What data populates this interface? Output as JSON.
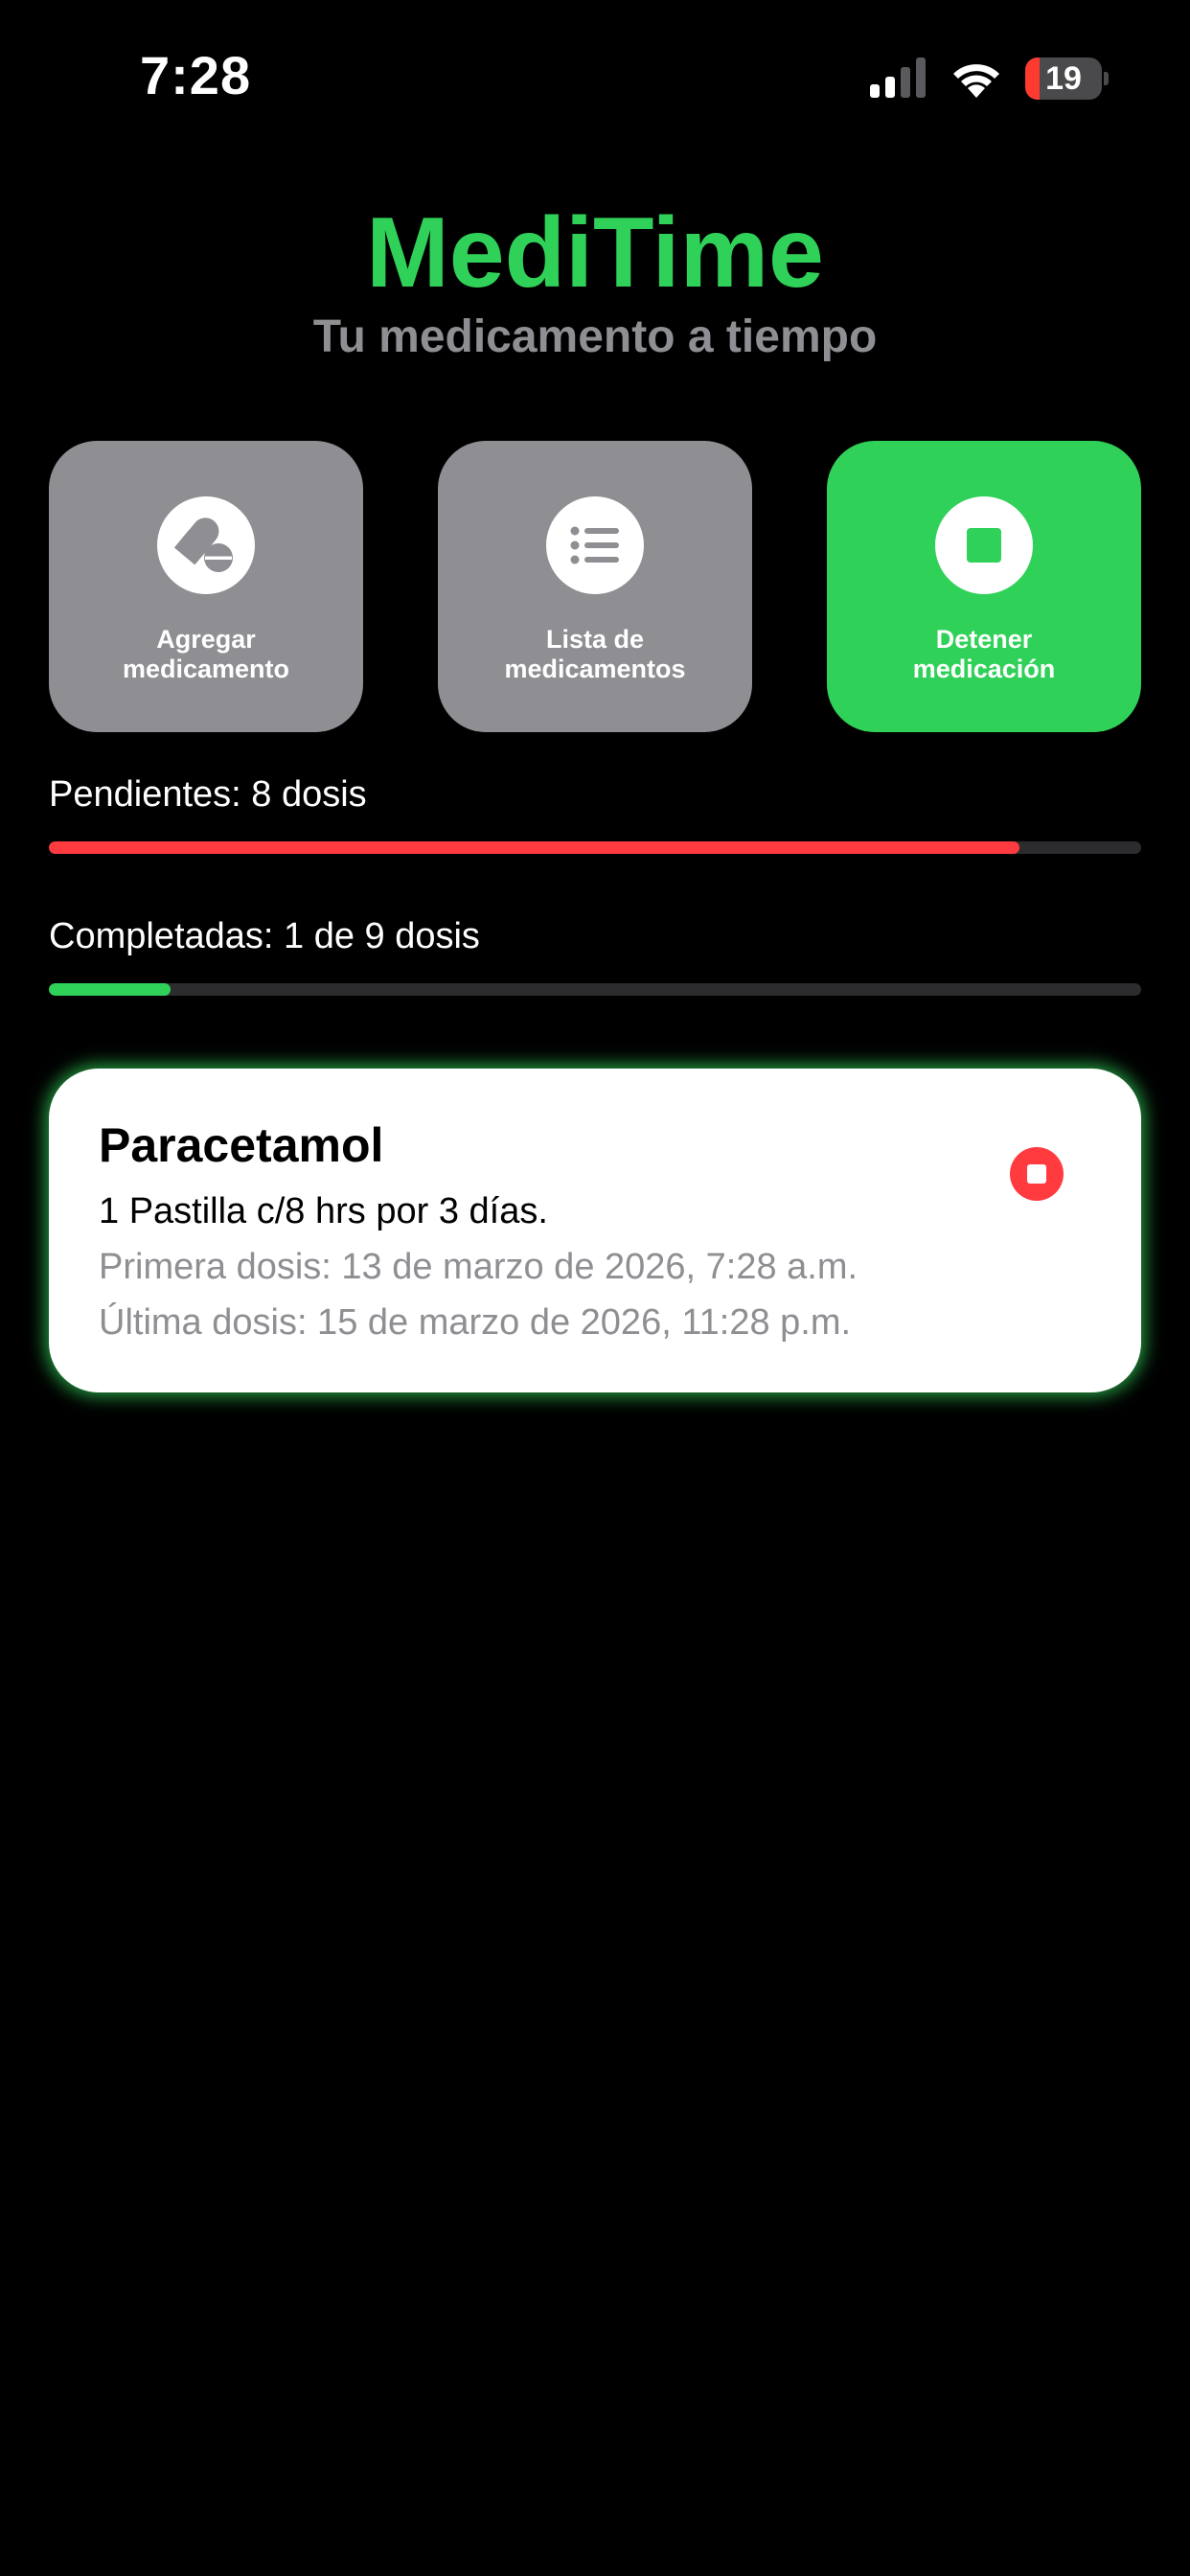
{
  "status_bar": {
    "time": "7:28",
    "battery_level": "19",
    "icons": [
      "signal-icon",
      "wifi-icon",
      "battery-icon"
    ]
  },
  "header": {
    "title": "MediTime",
    "subtitle": "Tu medicamento a tiempo"
  },
  "actions": [
    {
      "label": "Agregar\nmedicamento",
      "icon": "pills-icon",
      "color": "#8e8e93"
    },
    {
      "label": "Lista de\nmedicamentos",
      "icon": "list-icon",
      "color": "#8e8e93"
    },
    {
      "label": "Detener\nmedicación",
      "icon": "stop-icon",
      "color": "#30d158"
    }
  ],
  "progress": {
    "pending": {
      "label": "Pendientes: 8 dosis",
      "fraction": 0.889,
      "color": "#ff3b40"
    },
    "completed": {
      "label": "Completadas: 1 de 9 dosis",
      "fraction": 0.111,
      "color": "#30d158"
    }
  },
  "medication": {
    "name": "Paracetamol",
    "dosage": "1 Pastilla c/8 hrs por 3 días.",
    "first_dose": "Primera dosis: 13 de marzo de 2026, 7:28 a.m.",
    "last_dose": "Última dosis: 15 de marzo de 2026, 11:28 p.m.",
    "stop_icon": "stop-circle-icon",
    "accent": "#30d158"
  }
}
